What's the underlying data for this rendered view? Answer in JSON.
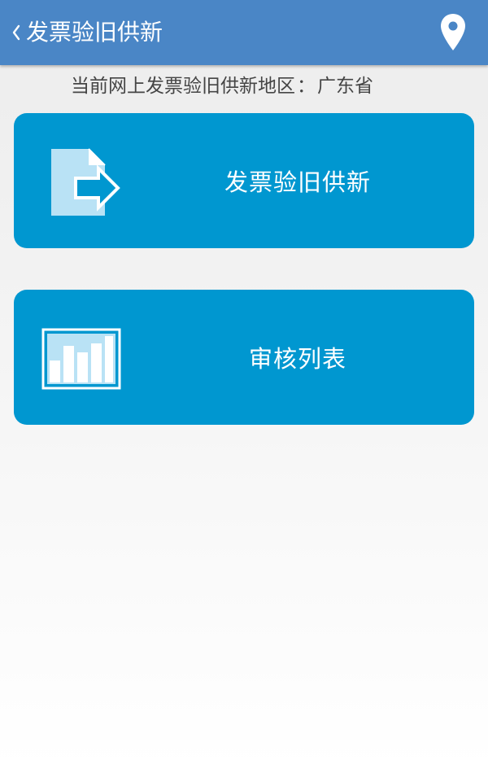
{
  "header": {
    "back_icon": "chevron-left-icon",
    "title": "发票验旧供新",
    "location_icon": "map-pin-icon"
  },
  "region": {
    "label": "当前网上发票验旧供新地区",
    "separator": "：",
    "value": "广东省"
  },
  "menu": [
    {
      "label": "发票验旧供新",
      "icon": "document-arrow-icon"
    },
    {
      "label": "审核列表",
      "icon": "bar-chart-icon"
    }
  ],
  "colors": {
    "header_bg": "#4a86c6",
    "card_bg": "#0097d0",
    "icon_light": "#b9e2f5"
  }
}
